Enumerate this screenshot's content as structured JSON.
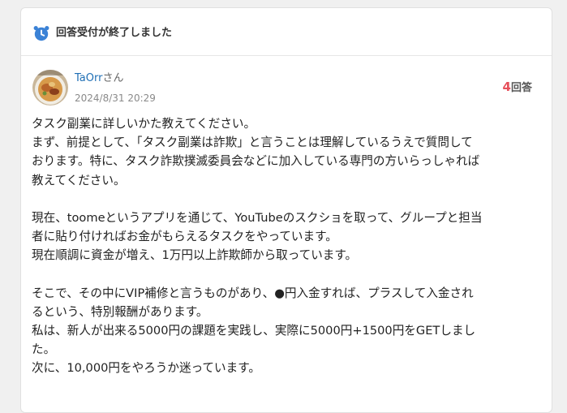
{
  "status": {
    "icon": "alarm-clock-icon",
    "text": "回答受付が終了しました"
  },
  "author": {
    "name": "TaOrr",
    "suffix": "さん",
    "posted_at": "2024/8/31 20:29",
    "avatar": "food-photo-avatar"
  },
  "answers": {
    "count": "4",
    "unit": "回答"
  },
  "question": {
    "lines": [
      "タスク副業に詳しいかた教えてください。",
      "まず、前提として、「タスク副業は詐欺」と言うことは理解しているうえで質問して",
      "おります。特に、タスク詐欺撲滅委員会などに加入している専門の方いらっしゃれば",
      "教えてください。",
      "",
      "現在、toomeというアプリを通じて、YouTubeのスクショを取って、グループと担当",
      "者に貼り付ければお金がもらえるタスクをやっています。",
      "現在順調に資金が増え、1万円以上詐欺師から取っています。",
      "",
      "そこで、その中にVIP補修と言うものがあり、●円入金すれば、プラスして入金され",
      "るという、特別報酬があります。",
      "私は、新人が出来る5000円の課題を実践し、実際に5000円+1500円をGETしまし",
      "た。",
      "次に、10,000円をやろうか迷っています。"
    ]
  },
  "colors": {
    "accent_blue": "#1f6fb5",
    "icon_blue": "#3b82d6",
    "answer_count_red": "#e64f5a"
  }
}
